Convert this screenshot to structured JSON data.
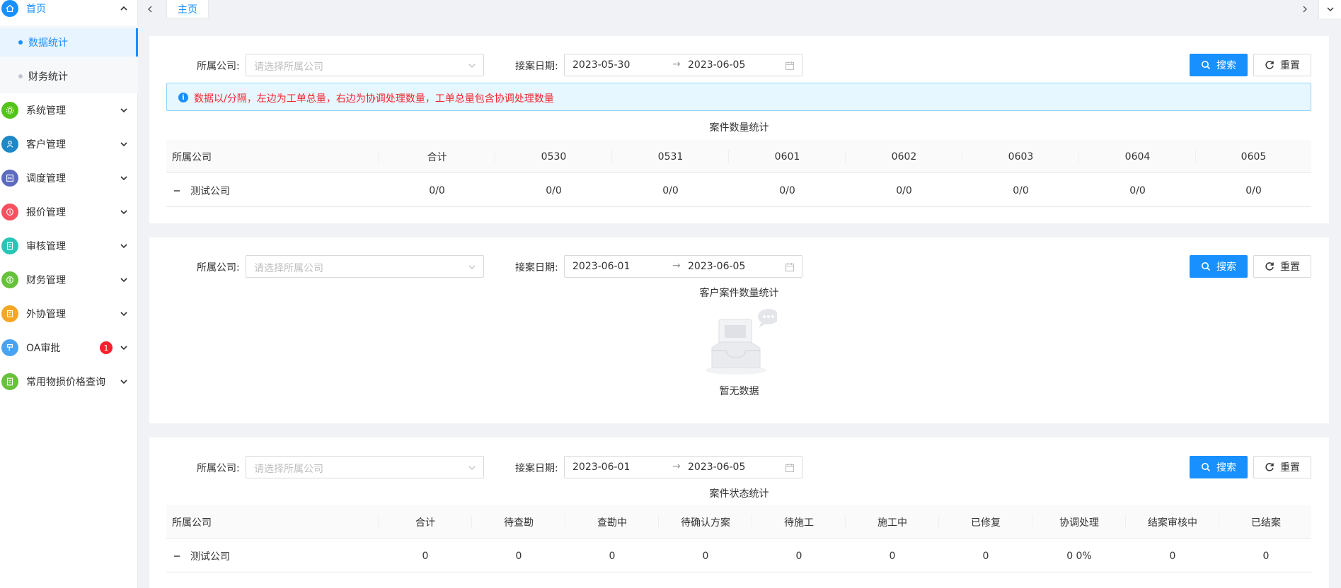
{
  "sidebar": {
    "home": {
      "label": "首页",
      "icon": "home-icon"
    },
    "sub_items": [
      {
        "label": "数据统计",
        "active": true
      },
      {
        "label": "财务统计",
        "active": false
      }
    ],
    "items": [
      {
        "label": "系统管理",
        "icon": "settings-icon",
        "color": "#52c41a"
      },
      {
        "label": "客户管理",
        "icon": "customer-icon",
        "color": "#1e88c7"
      },
      {
        "label": "调度管理",
        "icon": "dispatch-icon",
        "color": "#5c6bc0"
      },
      {
        "label": "报价管理",
        "icon": "quote-icon",
        "color": "#f5515f"
      },
      {
        "label": "审核管理",
        "icon": "audit-icon",
        "color": "#26c6b6"
      },
      {
        "label": "财务管理",
        "icon": "finance-icon",
        "color": "#66c23a"
      },
      {
        "label": "外协管理",
        "icon": "outsource-icon",
        "color": "#f5a623"
      },
      {
        "label": "OA审批",
        "icon": "oa-icon",
        "color": "#4aa3f0",
        "badge": "1"
      },
      {
        "label": "常用物损价格查询",
        "icon": "price-query-icon",
        "color": "#66c23a"
      }
    ]
  },
  "tabs": {
    "active": "主页"
  },
  "filter_labels": {
    "company": "所属公司:",
    "date": "接案日期:"
  },
  "company_placeholder": "请选择所属公司",
  "date_range_arrow": "→",
  "buttons": {
    "search": "搜索",
    "reset": "重置"
  },
  "panel1": {
    "date_start": "2023-05-30",
    "date_end": "2023-06-05",
    "alert": "数据以/分隔，左边为工单总量，右边为协调处理数量，工单总量包含协调处理数量",
    "table_title": "案件数量统计",
    "columns": [
      "所属公司",
      "合计",
      "0530",
      "0531",
      "0601",
      "0602",
      "0603",
      "0604",
      "0605"
    ],
    "rows": [
      [
        "测试公司",
        "0/0",
        "0/0",
        "0/0",
        "0/0",
        "0/0",
        "0/0",
        "0/0",
        "0/0"
      ]
    ]
  },
  "panel2": {
    "date_start": "2023-06-01",
    "date_end": "2023-06-05",
    "table_title": "客户案件数量统计",
    "empty_text": "暂无数据"
  },
  "panel3": {
    "date_start": "2023-06-01",
    "date_end": "2023-06-05",
    "table_title": "案件状态统计",
    "columns": [
      "所属公司",
      "合计",
      "待查勘",
      "查勘中",
      "待确认方案",
      "待施工",
      "施工中",
      "已修复",
      "协调处理",
      "结案审核中",
      "已结案"
    ],
    "rows": [
      [
        "测试公司",
        "0",
        "0",
        "0",
        "0",
        "0",
        "0",
        "0",
        "0 0%",
        "0",
        "0"
      ]
    ]
  },
  "colors": {
    "primary": "#1890ff",
    "alert_text": "#f5222d",
    "badge": "#f5222d"
  }
}
